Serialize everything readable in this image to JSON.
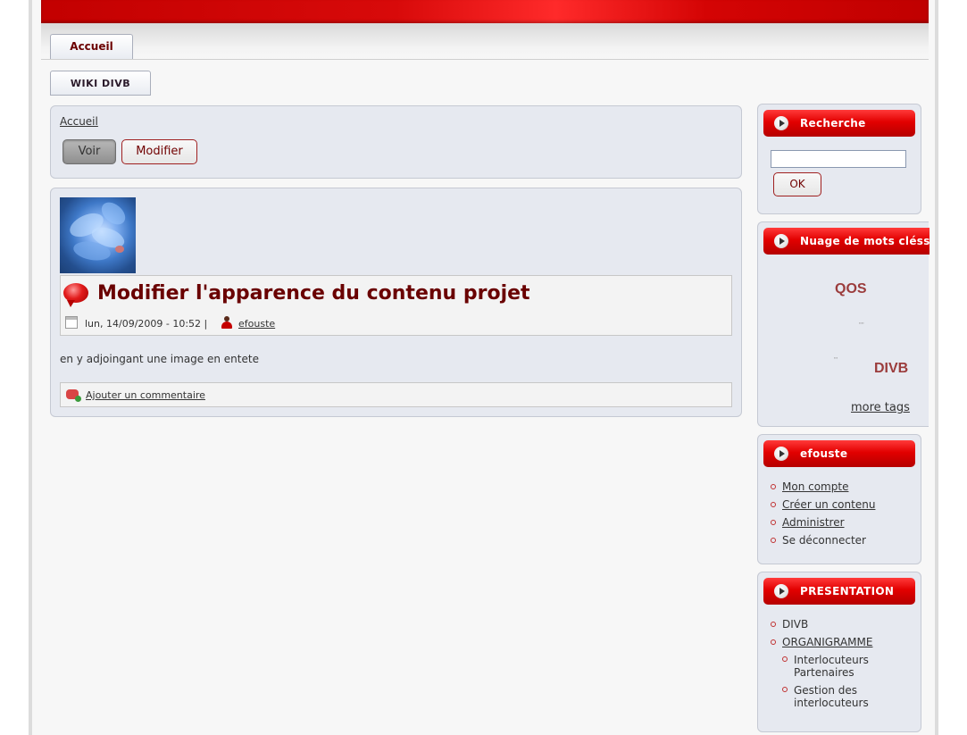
{
  "tabs": {
    "home": "Accueil",
    "wiki": "WIKI DIVB"
  },
  "breadcrumb": {
    "home": "Accueil"
  },
  "actions": {
    "view": "Voir",
    "edit": "Modifier"
  },
  "node": {
    "title": "Modifier l'apparence du contenu projet",
    "date": "lun, 14/09/2009 - 10:52 |",
    "author": "efouste",
    "body": "en y adjoingant une image en entete",
    "comment_link": "Ajouter un commentaire"
  },
  "search": {
    "title": "Recherche",
    "value": "",
    "button": "OK"
  },
  "tag_cloud": {
    "title": "Nuage de mots cléss",
    "tags": [
      "QOS",
      "DIVB"
    ],
    "more": "more tags"
  },
  "user_block": {
    "title": "efouste",
    "items": [
      "Mon compte",
      "Créer un contenu",
      "Administrer",
      "Se déconnecter"
    ]
  },
  "presentation": {
    "title": "PRESENTATION",
    "items": [
      "DIVB",
      "ORGANIGRAMME"
    ],
    "subitems": [
      "Interlocuteurs Partenaires",
      "Gestion des interlocuteurs"
    ]
  },
  "colors": {
    "accent": "#d00000",
    "title": "#6a0000",
    "panel": "#e6e9f0"
  },
  "icons": [
    "calendar-icon",
    "user-icon",
    "speech-bubble-icon",
    "comment-add-icon",
    "play-icon"
  ]
}
